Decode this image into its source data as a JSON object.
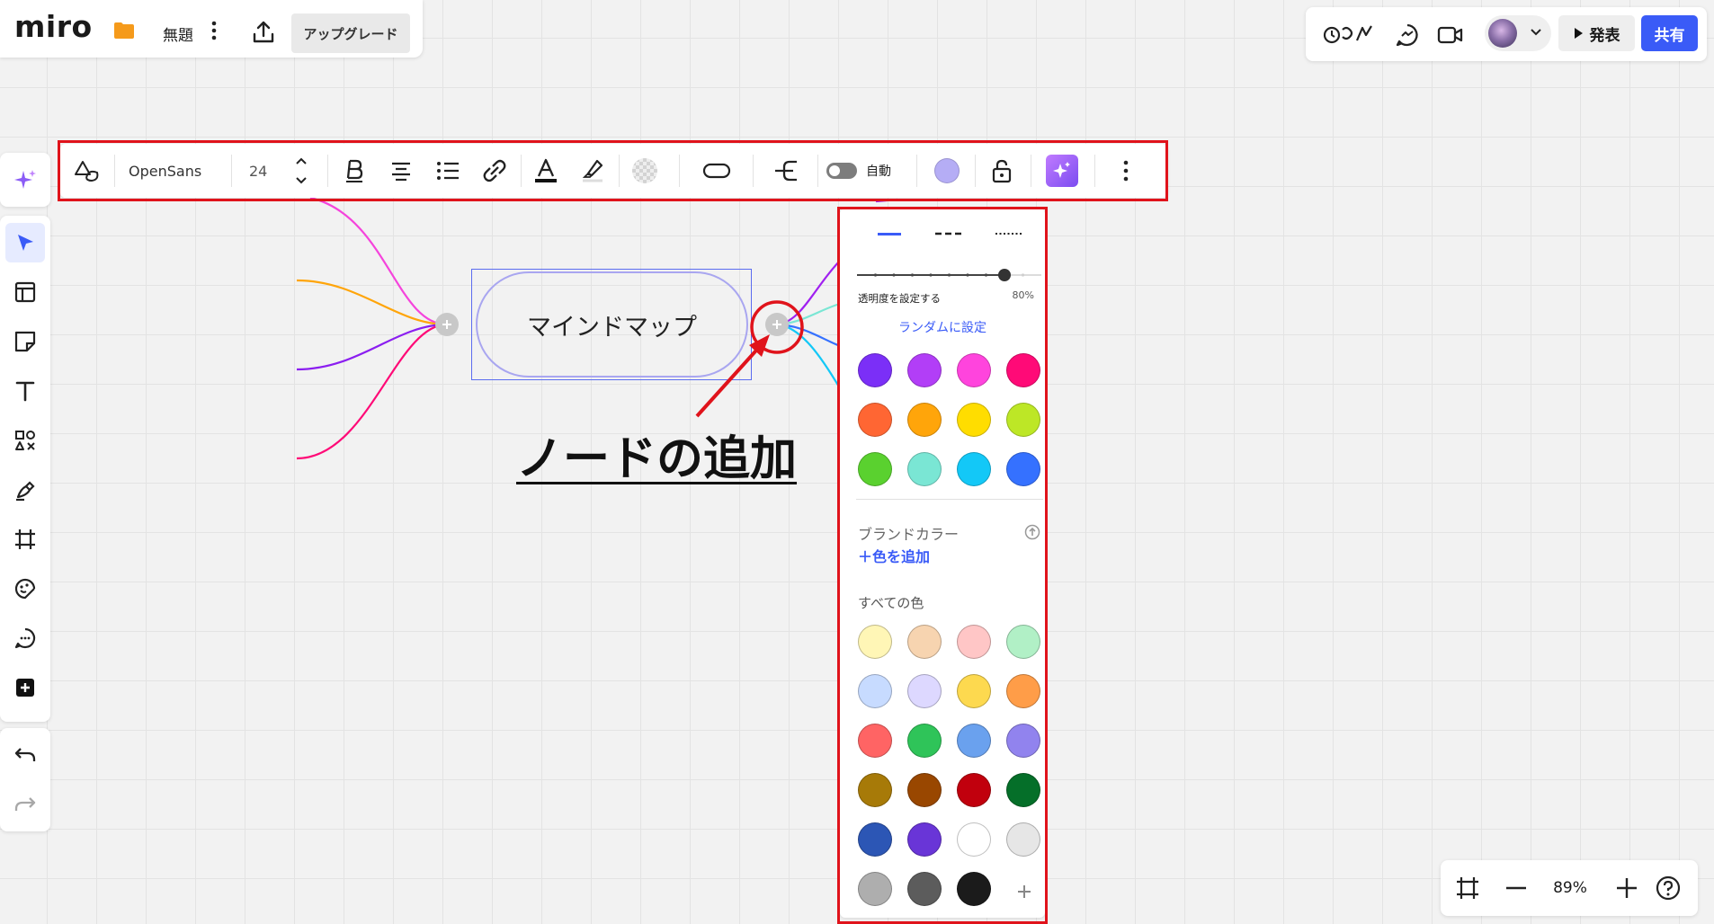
{
  "header": {
    "logo": "miro",
    "board_title": "無題",
    "upgrade_label": "アップグレード"
  },
  "topright": {
    "present_label": "発表",
    "share_label": "共有"
  },
  "toolbar": {
    "font": "OpenSans",
    "font_size": "24",
    "auto_label": "自動"
  },
  "canvas": {
    "node_text": "マインドマップ",
    "annotation": "ノードの追加"
  },
  "color_panel": {
    "opacity_label": "透明度を設定する",
    "opacity_value": "80%",
    "opacity": 0.8,
    "random_label": "ランダムに設定",
    "brand_title": "ブランドカラー",
    "add_color_label": "＋色を追加",
    "all_colors_title": "すべての色",
    "main_colors": [
      "#7b2ff7",
      "#b23ef7",
      "#ff44dd",
      "#ff0a77",
      "#ff6633",
      "#ffa50a",
      "#ffdd00",
      "#bde726",
      "#5ad12f",
      "#7ae6d4",
      "#13c8f7",
      "#3571ff"
    ],
    "all_colors": [
      "#fff6b6",
      "#f7d4b0",
      "#ffc6c6",
      "#b1f0c6",
      "#c7dbff",
      "#ddd8ff",
      "#fdd94f",
      "#ff9d48",
      "#ff6464",
      "#2fc459",
      "#6aa1ee",
      "#9183ee",
      "#a77a08",
      "#994700",
      "#c1000d",
      "#056f29",
      "#2c56b5",
      "#6935d7",
      "#ffffff",
      "#e6e6e6",
      "#aeaeae",
      "#5c5c5c",
      "#1b1b1b"
    ]
  },
  "zoom": {
    "value": "89%"
  }
}
